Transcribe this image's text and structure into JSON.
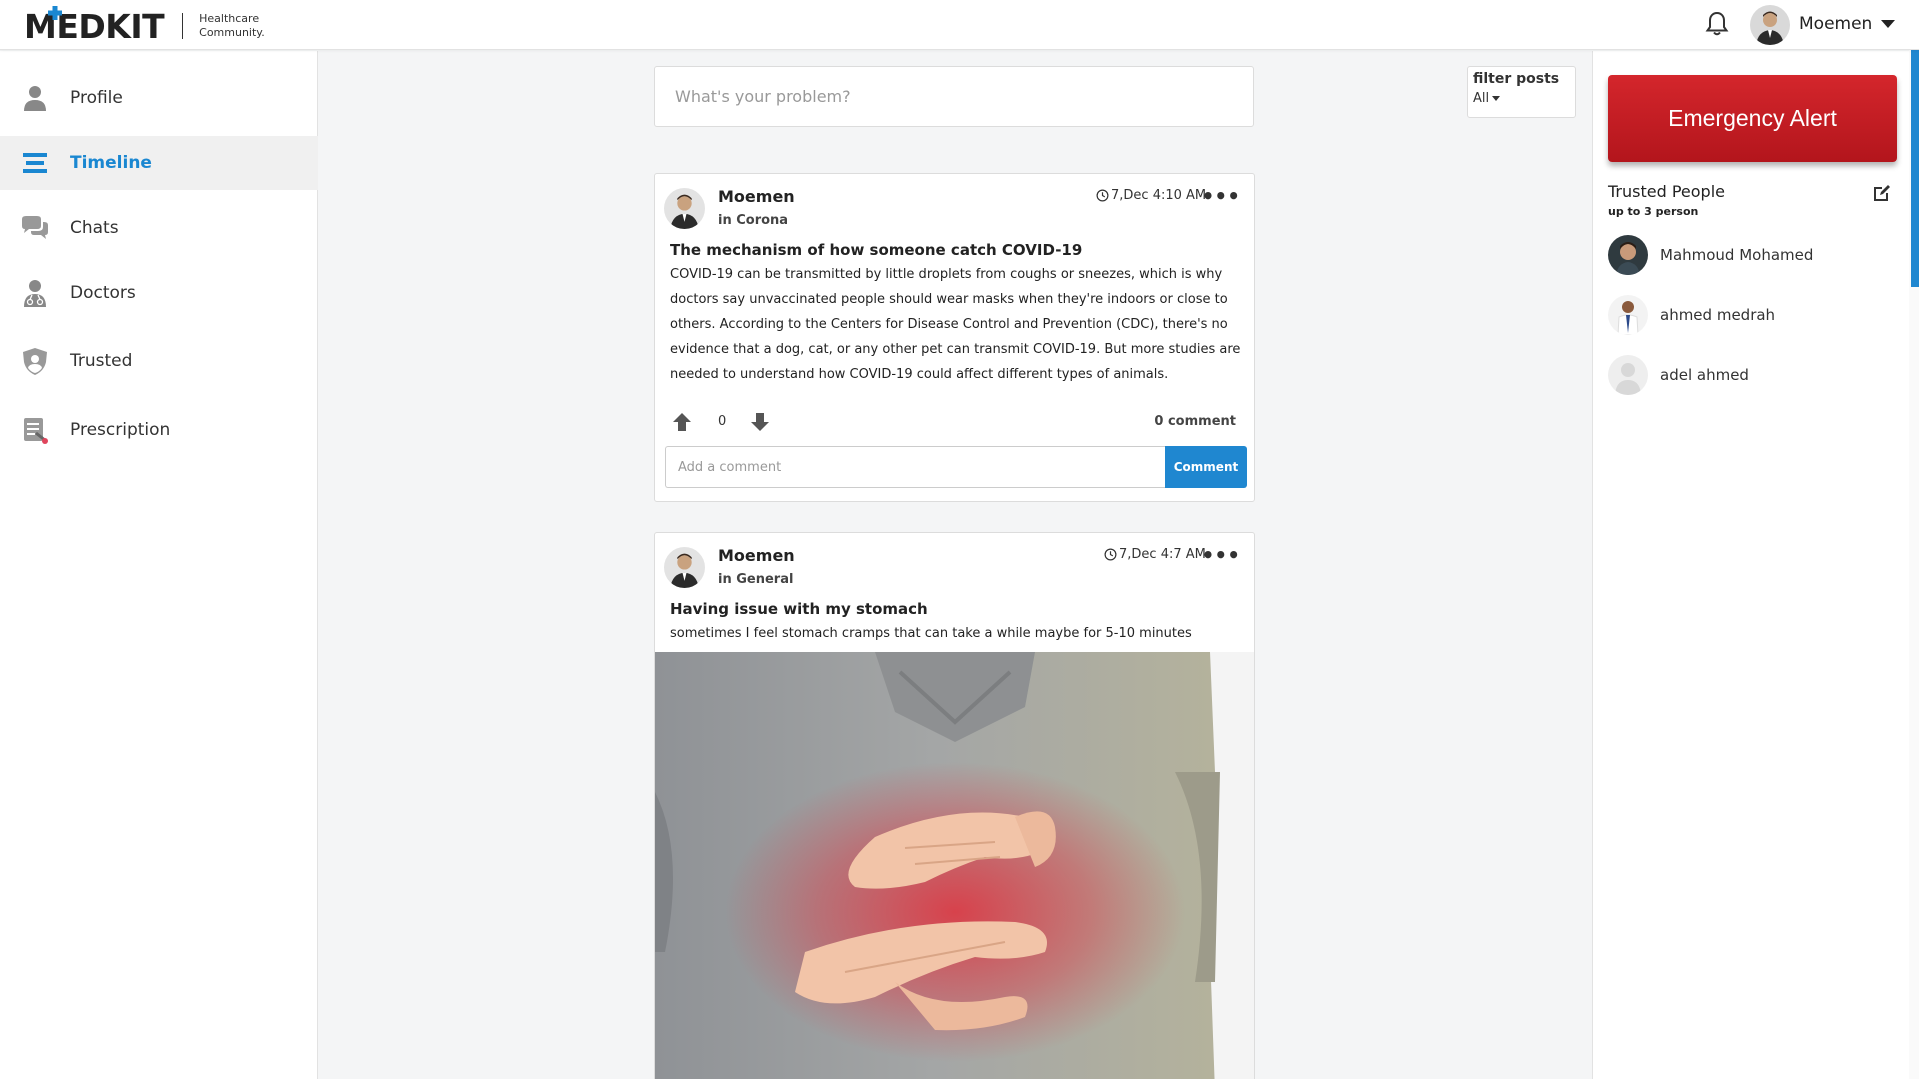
{
  "brand": {
    "name": "MEDKIT",
    "tagline_1": "Healthcare",
    "tagline_2": "Community."
  },
  "user": {
    "name": "Moemen"
  },
  "sidebar": {
    "items": [
      {
        "label": "Profile",
        "icon": "person-icon"
      },
      {
        "label": "Timeline",
        "icon": "timeline-icon",
        "active": true
      },
      {
        "label": "Chats",
        "icon": "chat-icon"
      },
      {
        "label": "Doctors",
        "icon": "doctor-icon"
      },
      {
        "label": "Trusted",
        "icon": "shield-icon"
      },
      {
        "label": "Prescription",
        "icon": "prescription-icon"
      }
    ]
  },
  "composer": {
    "placeholder": "What's your problem?"
  },
  "filter": {
    "label": "filter posts",
    "value": "All"
  },
  "posts": [
    {
      "author": "Moemen",
      "category": "in Corona",
      "time": "7,Dec 4:10 AM",
      "title": "The mechanism of how someone catch COVID-19",
      "body": "COVID-19 can be transmitted by little droplets from coughs or sneezes, which is why doctors say unvaccinated people should wear masks when they're indoors or close to others. According to the Centers for Disease Control and Prevention (CDC), there's no evidence that a dog, cat, or any other pet can transmit COVID-19. But more studies are needed to understand how COVID-19 could affect different types of animals.",
      "votes": "0",
      "comments": "0 comment",
      "comment_placeholder": "Add a comment",
      "comment_button": "Comment"
    },
    {
      "author": "Moemen",
      "category": "in General",
      "time": "7,Dec 4:7 AM",
      "title": "Having issue with my stomach",
      "body": "sometimes I feel stomach cramps that can take a while maybe for 5-10 minutes"
    }
  ],
  "right_panel": {
    "emergency_label": "Emergency Alert",
    "trusted_title": "Trusted People",
    "trusted_subtitle": "up to 3 person",
    "people": [
      {
        "name": "Mahmoud Mohamed"
      },
      {
        "name": "ahmed medrah"
      },
      {
        "name": "adel ahmed"
      }
    ]
  },
  "colors": {
    "accent": "#1f87d0",
    "emergency": "#c41e24",
    "background": "#f4f5f6"
  }
}
